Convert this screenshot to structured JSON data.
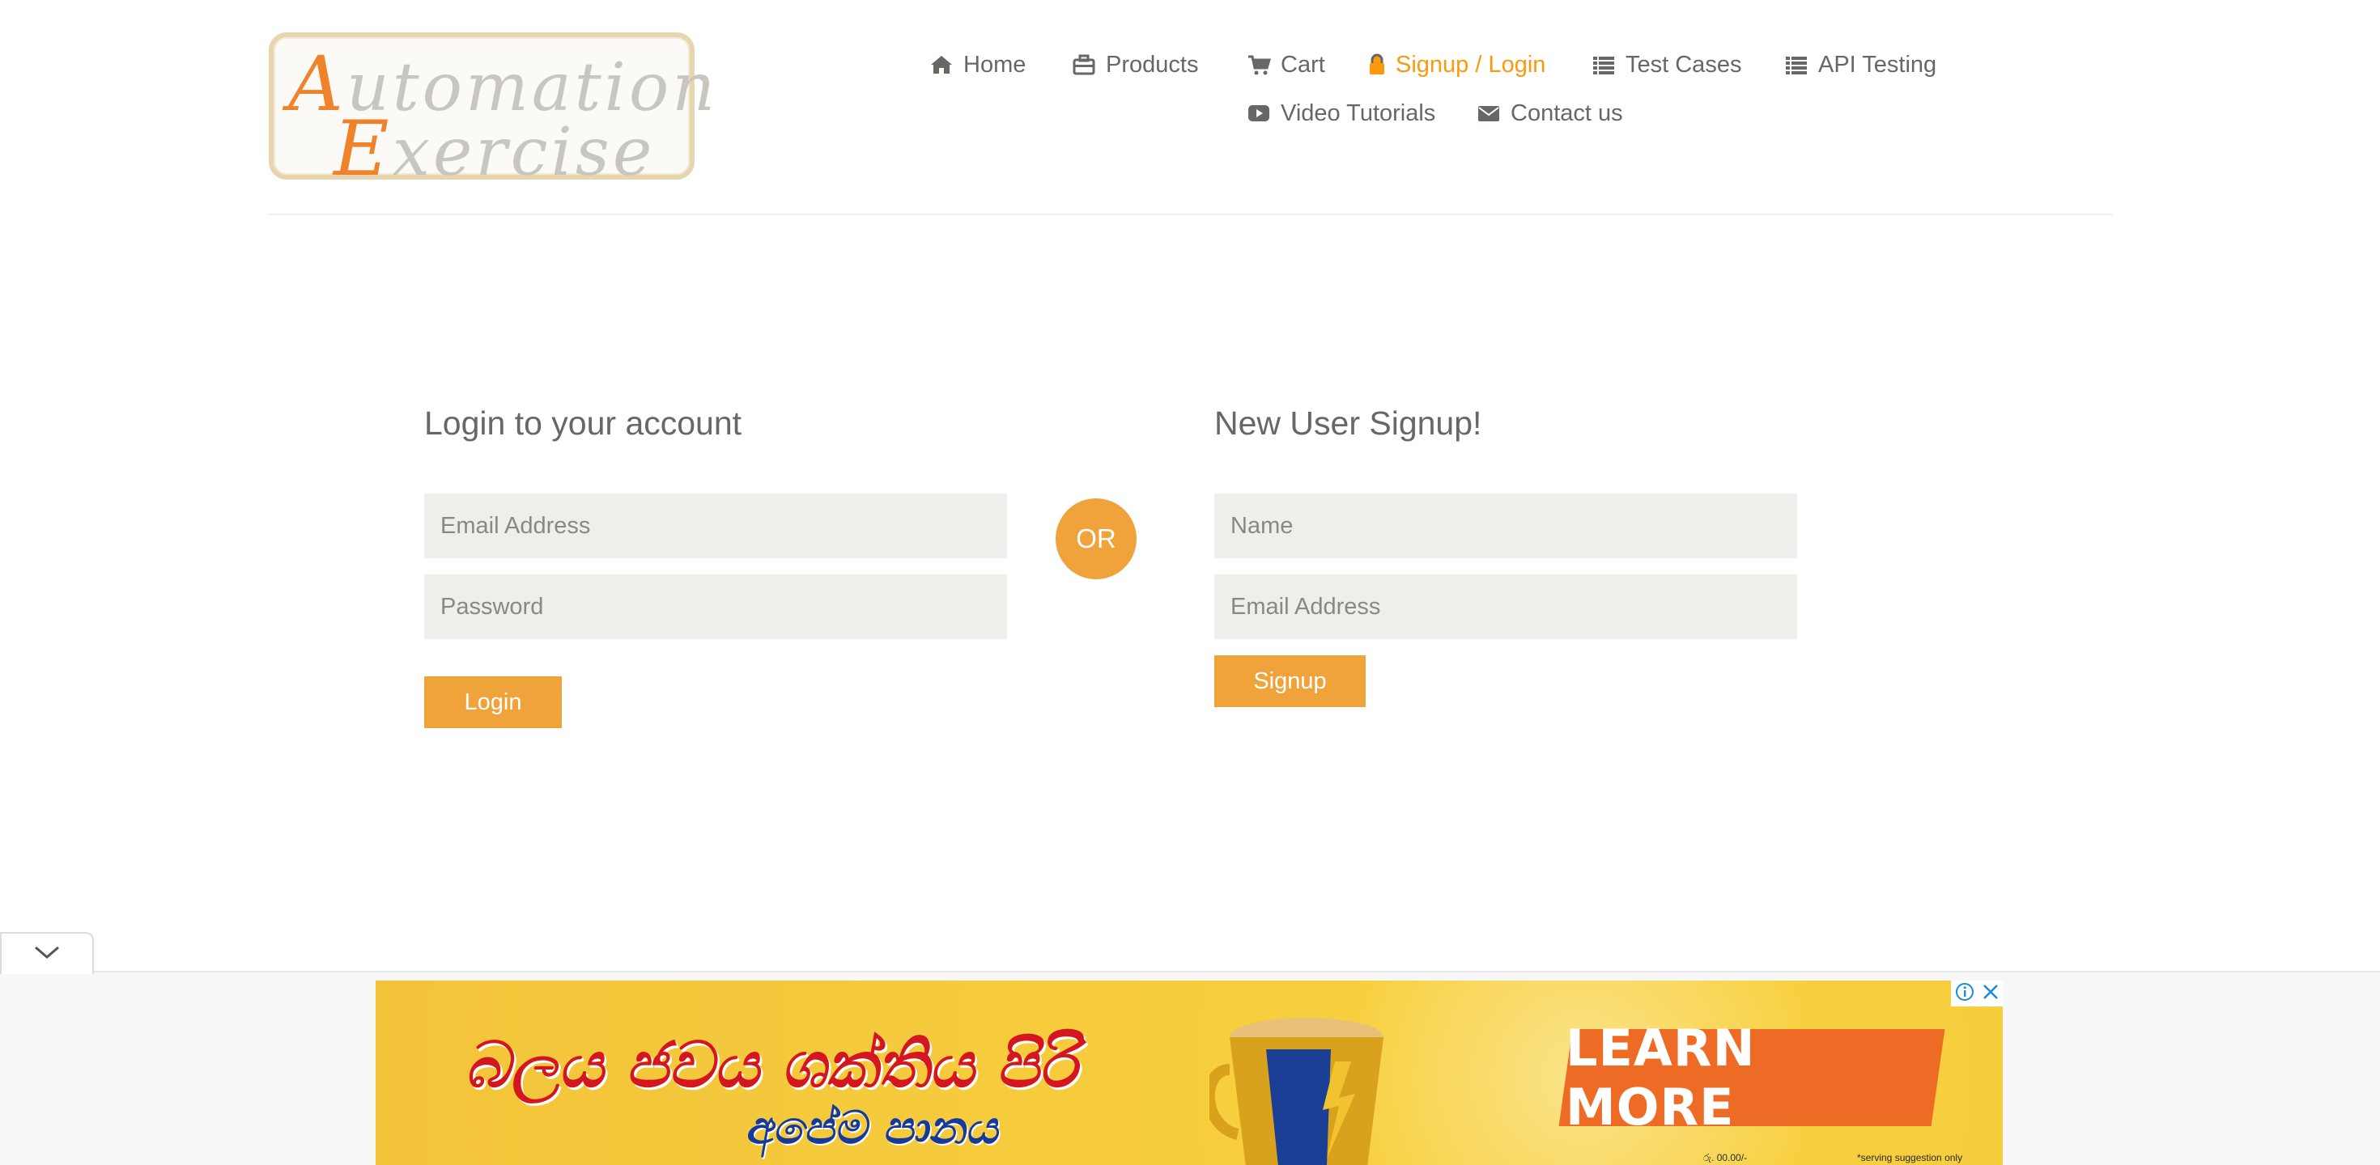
{
  "logo": {
    "line1_cap": "A",
    "line1_rest": "utomation",
    "line2_cap": "E",
    "line2_rest": "xercise"
  },
  "nav": {
    "items": [
      {
        "label": "Home",
        "icon": "home-icon",
        "active": false
      },
      {
        "label": "Products",
        "icon": "briefcase-icon",
        "active": false
      },
      {
        "label": "Cart",
        "icon": "cart-icon",
        "active": false
      },
      {
        "label": "Signup / Login",
        "icon": "lock-icon",
        "active": true
      },
      {
        "label": "Test Cases",
        "icon": "list-icon",
        "active": false
      },
      {
        "label": "API Testing",
        "icon": "list-icon",
        "active": false
      },
      {
        "label": "Video Tutorials",
        "icon": "youtube-play-icon",
        "active": false
      },
      {
        "label": "Contact us",
        "icon": "envelope-icon",
        "active": false
      }
    ]
  },
  "login": {
    "title": "Login to your account",
    "email_placeholder": "Email Address",
    "password_placeholder": "Password",
    "button_label": "Login"
  },
  "or_label": "OR",
  "signup": {
    "title": "New User Signup!",
    "name_placeholder": "Name",
    "email_placeholder": "Email Address",
    "button_label": "Signup"
  },
  "ad": {
    "headline": "බලය ජවය ශක්තිය පිරි",
    "subline": "අපේම පානය",
    "cta": "LEARN MORE",
    "fine_print_left": "රු. 00.00/-",
    "fine_print_right": "*serving suggestion only"
  },
  "colors": {
    "accent": "#FE980F",
    "button": "#F0A33A",
    "field_bg": "#EEEEEA",
    "text": "#696763"
  }
}
